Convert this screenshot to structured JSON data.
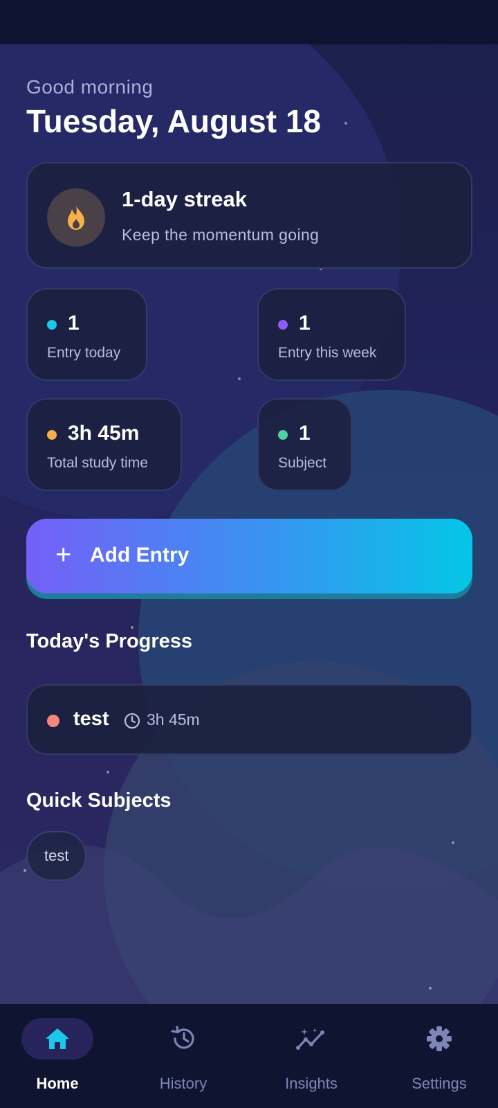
{
  "header": {
    "greeting": "Good morning",
    "date": "Tuesday, August 18"
  },
  "streak": {
    "icon": "flame-icon",
    "title": "1-day streak",
    "subtitle": "Keep the momentum going"
  },
  "stats": [
    {
      "value": "1",
      "label": "Entry today",
      "color": "#1ec8ea"
    },
    {
      "value": "1",
      "label": "Entry this week",
      "color": "#8b5cf6"
    },
    {
      "value": "3h 45m",
      "label": "Total study time",
      "color": "#f5b04a"
    },
    {
      "value": "1",
      "label": "Subject",
      "color": "#4fd1a5"
    }
  ],
  "add_entry": {
    "label": "Add Entry",
    "icon": "plus-icon"
  },
  "todays_progress": {
    "title": "Today's Progress",
    "items": [
      {
        "name": "test",
        "time": "3h 45m",
        "color": "#f5867a",
        "icon": "clock-icon"
      }
    ]
  },
  "quick_subjects": {
    "title": "Quick Subjects",
    "chips": [
      "test"
    ]
  },
  "nav": [
    {
      "label": "Home",
      "icon": "home-icon",
      "active": true
    },
    {
      "label": "History",
      "icon": "history-icon",
      "active": false
    },
    {
      "label": "Insights",
      "icon": "insights-icon",
      "active": false
    },
    {
      "label": "Settings",
      "icon": "gear-icon",
      "active": false
    }
  ],
  "colors": {
    "accent": "#04c6e6",
    "accent_purple": "#7460f6",
    "card_bg": "#1b2140",
    "nav_bg": "#0f1430"
  }
}
